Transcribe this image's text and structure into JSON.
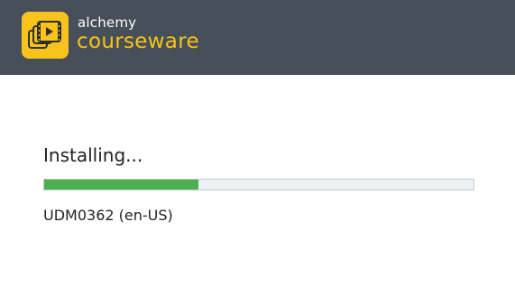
{
  "header": {
    "logo_icon": "film-stack-play-icon",
    "brand_small": "alchemy",
    "brand_large": "courseware",
    "background_color": "#474f58",
    "accent_color": "#f7c31c"
  },
  "installer": {
    "status_text": "Installing...",
    "package_text": "UDM0362 (en-US)",
    "progress_fraction": 0.36,
    "progress_color": "#4caf50"
  }
}
